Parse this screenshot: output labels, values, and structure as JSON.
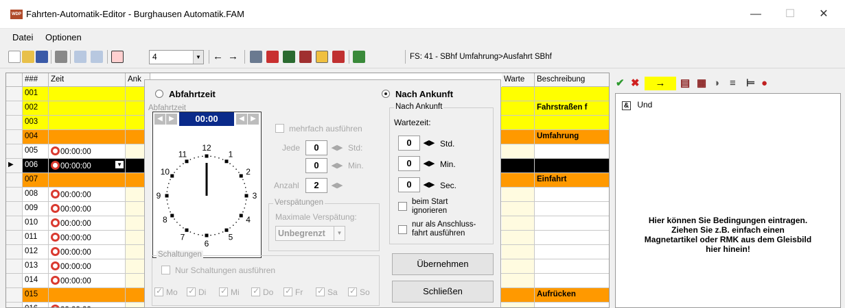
{
  "window": {
    "title": "Fahrten-Automatik-Editor - Burghausen Automatik.FAM",
    "icon_text": "WDP"
  },
  "window_controls": {
    "minimize": "—",
    "maximize": "☐",
    "close": "✕"
  },
  "menu": [
    "Datei",
    "Optionen"
  ],
  "toolbar": {
    "combo_value": "4",
    "status": "FS: 41 - SBhf Umfahrung>Ausfahrt SBhf"
  },
  "grid": {
    "headers": {
      "num": "###",
      "zeit": "Zeit",
      "ank": "Ank",
      "warte": "Warte",
      "beschreibung": "Beschreibung"
    },
    "rows": [
      {
        "num": "001",
        "zeit": "",
        "desc": ""
      },
      {
        "num": "002",
        "zeit": "",
        "desc": "Fahrstraßen f"
      },
      {
        "num": "003",
        "zeit": "",
        "desc": ""
      },
      {
        "num": "004",
        "zeit": "",
        "desc": "Umfahrung"
      },
      {
        "num": "005",
        "zeit": "00:00:00",
        "desc": ""
      },
      {
        "num": "006",
        "zeit": "00:00:00",
        "desc": ""
      },
      {
        "num": "007",
        "zeit": "",
        "desc": "Einfahrt"
      },
      {
        "num": "008",
        "zeit": "00:00:00",
        "desc": ""
      },
      {
        "num": "009",
        "zeit": "00:00:00",
        "desc": ""
      },
      {
        "num": "010",
        "zeit": "00:00:00",
        "desc": ""
      },
      {
        "num": "011",
        "zeit": "00:00:00",
        "desc": ""
      },
      {
        "num": "012",
        "zeit": "00:00:00",
        "desc": ""
      },
      {
        "num": "013",
        "zeit": "00:00:00",
        "desc": ""
      },
      {
        "num": "014",
        "zeit": "00:00:00",
        "desc": ""
      },
      {
        "num": "015",
        "zeit": "",
        "desc": "Aufrücken"
      },
      {
        "num": "016",
        "zeit": "00:00:00",
        "desc": ""
      }
    ]
  },
  "dialog": {
    "radio_abfahrt": "Abfahrtzeit",
    "radio_ankunft": "Nach Ankunft",
    "abfahrt_legend": "Abfahrtzeit",
    "time": "00:00",
    "clock_numbers": [
      "12",
      "1",
      "2",
      "3",
      "4",
      "5",
      "6",
      "7",
      "8",
      "9",
      "10",
      "11"
    ],
    "mehrfach": "mehrfach ausführen",
    "jede_label": "Jede",
    "jede_std": "0",
    "std_label": "Std:",
    "jede_min": "0",
    "min_label": "Min.",
    "anzahl_label": "Anzahl",
    "anzahl": "2",
    "verspaetungen_legend": "Verspätungen",
    "max_verspaetung": "Maximale Verspätung:",
    "verspaetung_value": "Unbegrenzt",
    "ankunft_legend": "Nach Ankunft",
    "wartezeit": "Wartezeit:",
    "wait_std": "0",
    "wait_std_label": "Std.",
    "wait_min": "0",
    "wait_min_label": "Min.",
    "wait_sec": "0",
    "wait_sec_label": "Sec.",
    "start_ignore_1": "beim Start",
    "start_ignore_2": "ignorieren",
    "anschluss_1": "nur als Anschluss-",
    "anschluss_2": "fahrt ausführen",
    "schaltungen_legend": "Schaltungen",
    "nur_schaltungen": "Nur Schaltungen ausführen",
    "days": [
      "Mo",
      "Di",
      "Mi",
      "Do",
      "Fr",
      "Sa",
      "So"
    ],
    "btn_uebernehmen": "Übernehmen",
    "btn_schliessen": "Schließen"
  },
  "right_panel": {
    "condition": "Und",
    "condition_icon": "&",
    "hint": [
      "Hier können Sie Bedingungen eintragen.",
      "Ziehen Sie z.B. einfach einen",
      "Magnetartikel oder RMK aus dem Gleisbild",
      "hier hinein!"
    ]
  },
  "colors": {
    "yellow_row": "#ffff00",
    "orange_row": "#ff9900",
    "selected_row": "#000000",
    "accent_blue": "#0a2a8a",
    "clock_red": "#d93a30"
  }
}
